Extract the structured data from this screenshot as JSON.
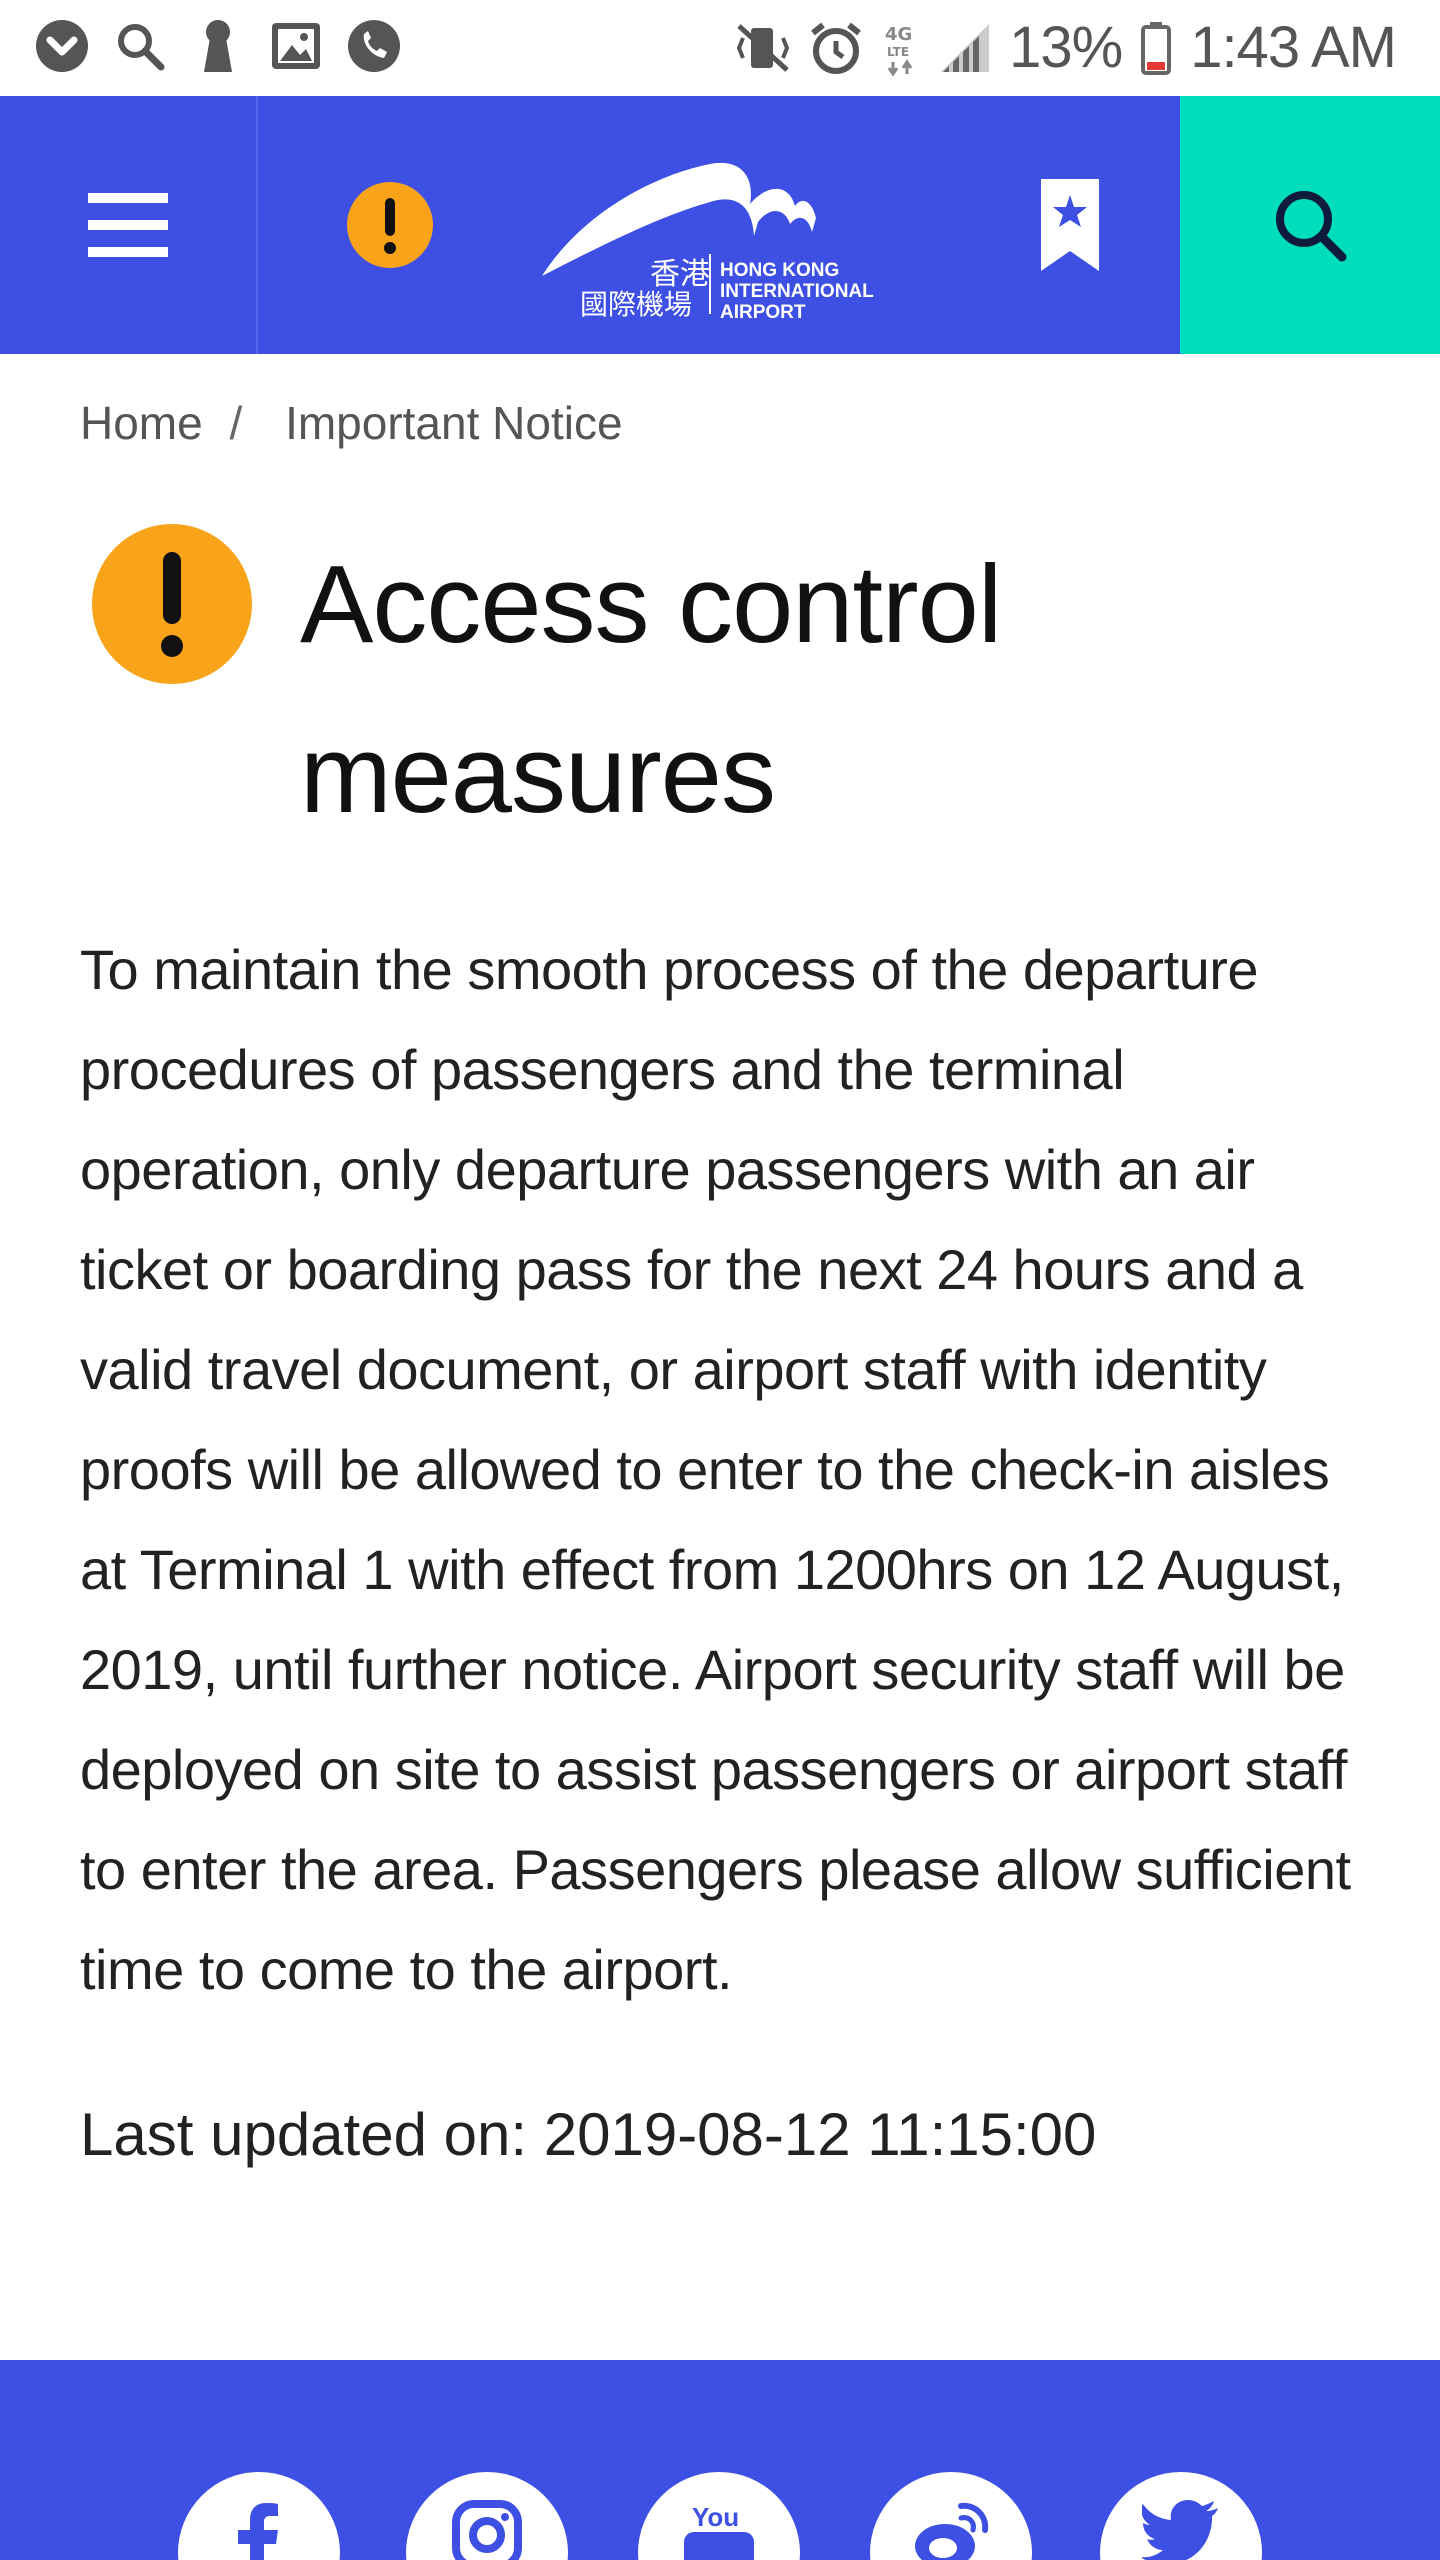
{
  "status_bar": {
    "battery_percent": "13%",
    "time": "1:43 AM",
    "network": "4G LTE",
    "left_icons": [
      "app-notification-icon",
      "search-icon",
      "keyhole-icon",
      "gallery-icon",
      "phone-icon"
    ],
    "right_icons": [
      "vibrate-mute-icon",
      "alarm-icon",
      "lte-icon",
      "signal-icon",
      "battery-icon"
    ]
  },
  "header": {
    "logo_cn": "香港國際機場",
    "logo_en_lines": [
      "HONG KONG",
      "INTERNATIONAL",
      "AIRPORT"
    ],
    "colors": {
      "primary": "#3d50e3",
      "search_bg": "#00dcbe",
      "alert": "#f9a31b"
    }
  },
  "breadcrumb": {
    "home": "Home",
    "separator": "/",
    "current": "Important Notice"
  },
  "notice": {
    "title": "Access control measures",
    "body": "To maintain the smooth process of the departure procedures of passengers and the terminal operation, only departure passengers with an air ticket or boarding pass for the next 24 hours and a valid travel document, or airport staff with identity proofs will be allowed to enter to the check-in aisles at Terminal 1 with effect from 1200hrs on 12 August, 2019, until further notice. Airport security staff will be deployed on site to assist passengers or airport staff to enter the area. Passengers please allow sufficient time to come to the airport.",
    "last_updated": "Last updated on: 2019-08-12 11:15:00"
  },
  "footer": {
    "social_icons": [
      "facebook-icon",
      "instagram-icon",
      "youtube-icon",
      "weibo-icon",
      "twitter-icon"
    ],
    "youtube_label": "You"
  }
}
